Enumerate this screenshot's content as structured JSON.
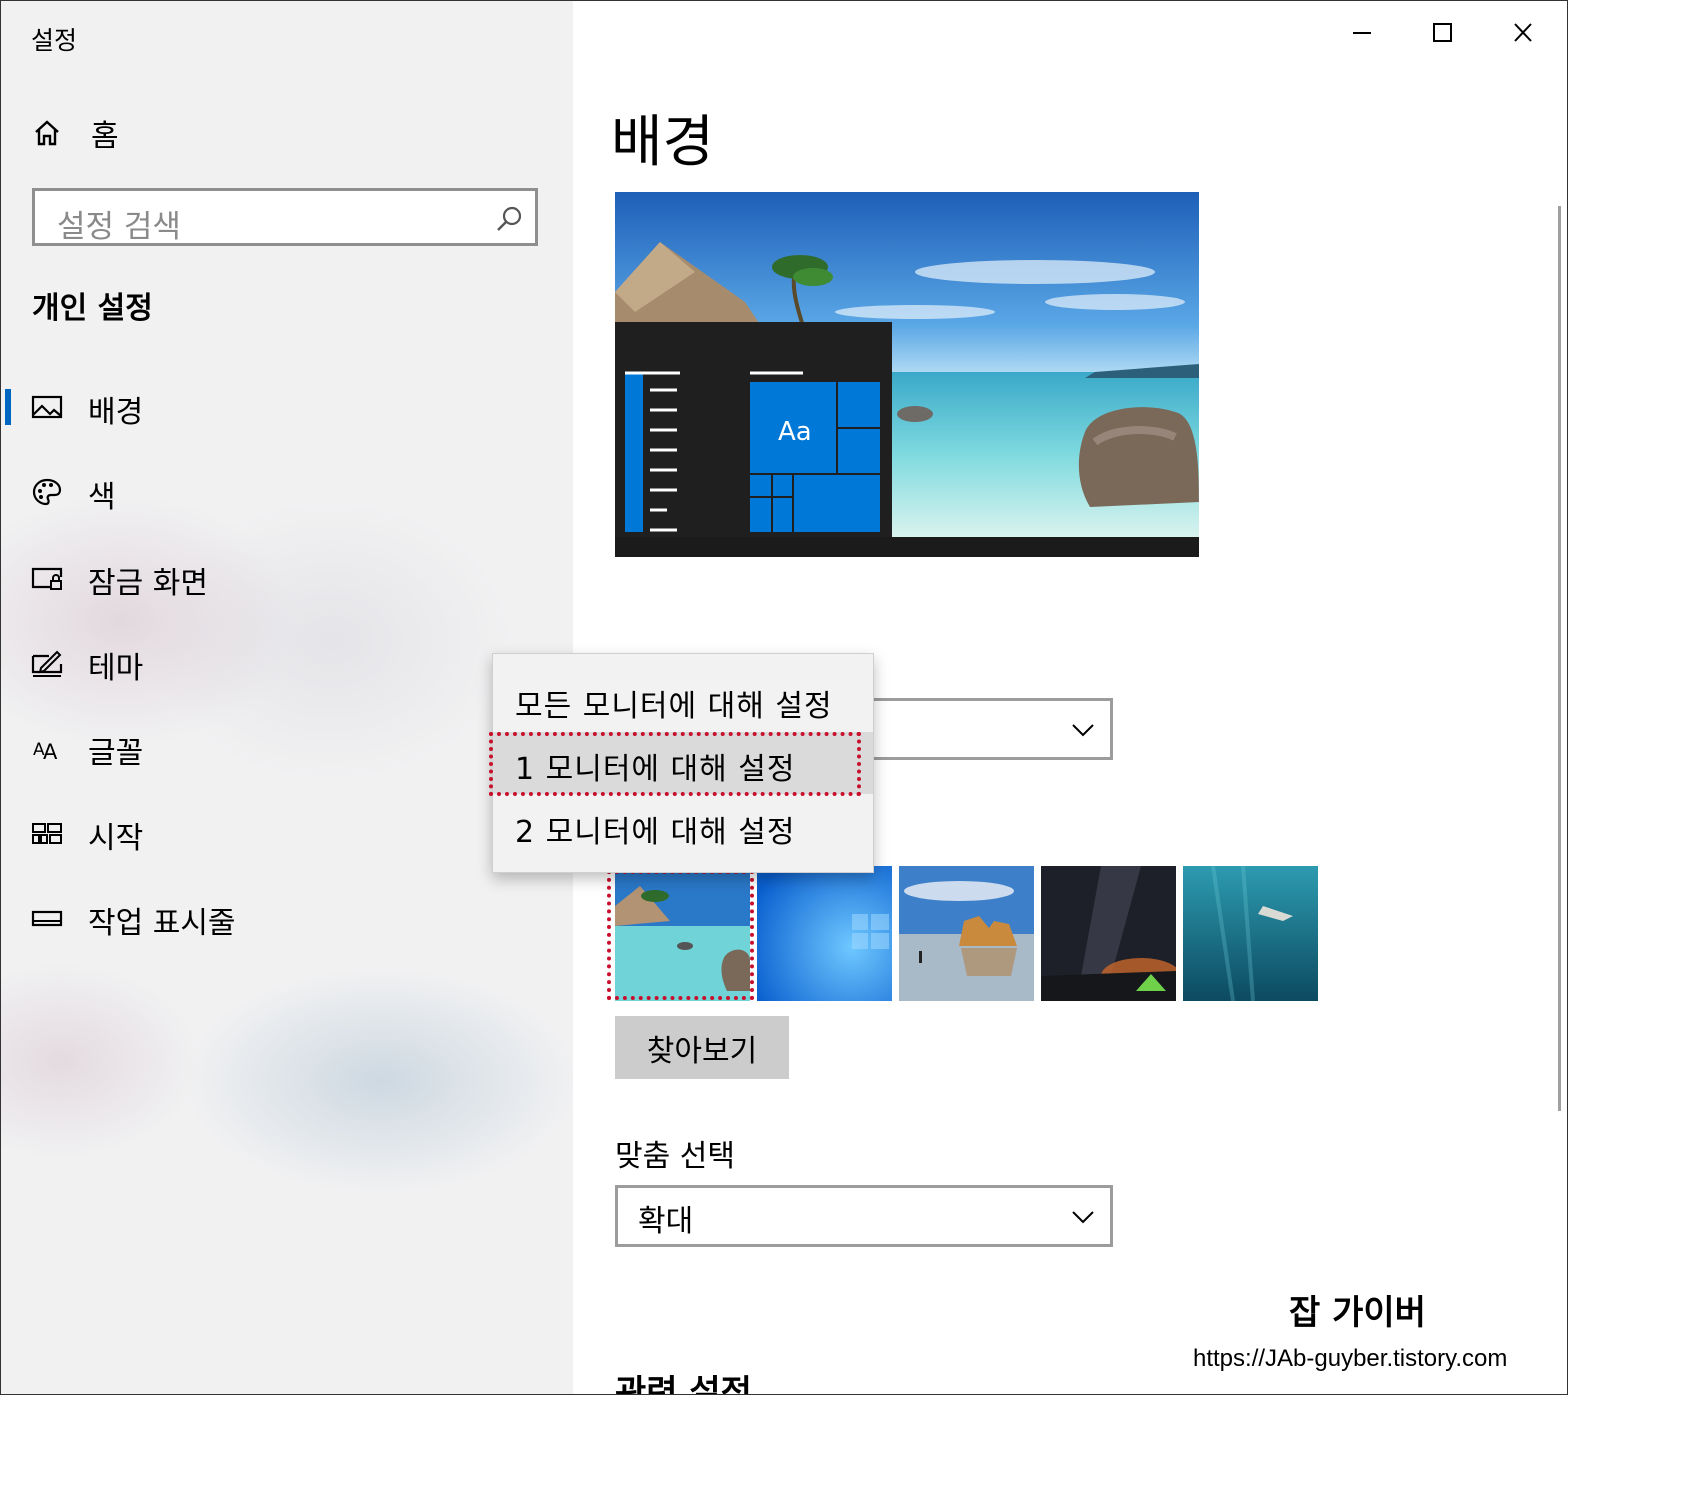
{
  "window": {
    "title": "설정",
    "controls": [
      "minimize",
      "maximize",
      "close"
    ]
  },
  "sidebar": {
    "home_label": "홈",
    "search_placeholder": "설정 검색",
    "section_title": "개인 설정",
    "items": [
      {
        "label": "배경",
        "icon": "picture-icon",
        "active": true
      },
      {
        "label": "색",
        "icon": "palette-icon",
        "active": false
      },
      {
        "label": "잠금 화면",
        "icon": "lock-screen-icon",
        "active": false
      },
      {
        "label": "테마",
        "icon": "theme-brush-icon",
        "active": false
      },
      {
        "label": "글꼴",
        "icon": "font-icon",
        "active": false
      },
      {
        "label": "시작",
        "icon": "start-tiles-icon",
        "active": false
      },
      {
        "label": "작업 표시줄",
        "icon": "taskbar-icon",
        "active": false
      }
    ]
  },
  "main": {
    "title": "배경",
    "preview": {
      "tile_text": "Aa"
    },
    "background_dropdown": {
      "value": ""
    },
    "browse_button": "찾아보기",
    "fit_label": "맞춤 선택",
    "fit_dropdown": {
      "value": "확대"
    },
    "related_settings": "관련 설정",
    "thumbnails": [
      "beach-resort",
      "windows-blue",
      "rock-arch-beach",
      "milky-way-tent",
      "underwater-swimmer"
    ]
  },
  "context_menu": {
    "items": [
      {
        "label": "모든 모니터에 대해 설정",
        "highlighted": false
      },
      {
        "label": "1 모니터에 대해 설정",
        "highlighted": true
      },
      {
        "label": "2 모니터에 대해 설정",
        "highlighted": false
      }
    ]
  },
  "watermark": {
    "title": "잡 가이버",
    "url": "https://JAb-guyber.tistory.com"
  },
  "colors": {
    "accent": "#0067c0",
    "annotation": "#c8102e",
    "tile_blue": "#0078d7"
  }
}
